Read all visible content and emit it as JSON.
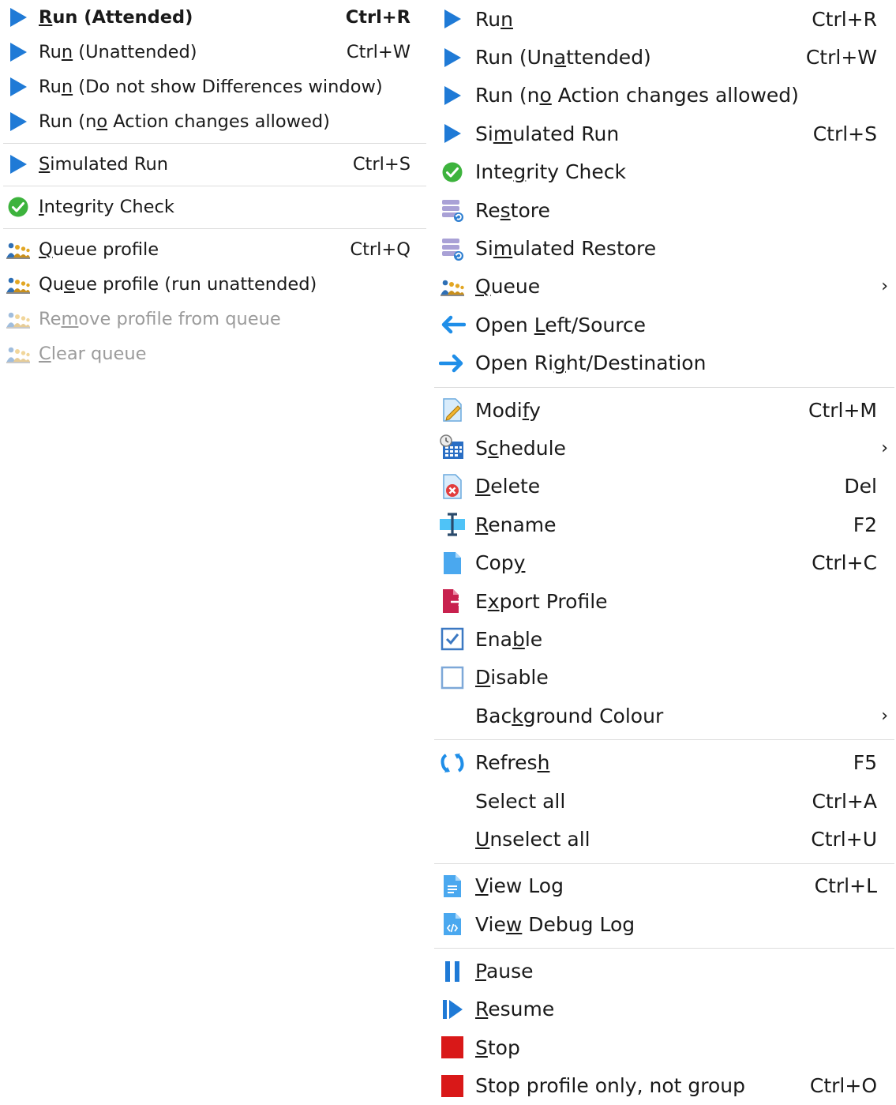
{
  "left_menu": [
    {
      "icon": "play-icon",
      "pre": "",
      "ul": "R",
      "post": "un (Attended)",
      "shortcut": "Ctrl+R",
      "bold": true
    },
    {
      "icon": "play-icon",
      "pre": "Ru",
      "ul": "n",
      "post": " (Unattended)",
      "shortcut": "Ctrl+W"
    },
    {
      "icon": "play-icon",
      "pre": "Ru",
      "ul": "n",
      "post": " (Do not show Differences window)",
      "shortcut": ""
    },
    {
      "icon": "play-icon",
      "pre": "Run (n",
      "ul": "o",
      "post": " Action changes allowed)",
      "shortcut": ""
    },
    {
      "sep": true
    },
    {
      "icon": "play-icon",
      "pre": "",
      "ul": "S",
      "post": "imulated Run",
      "shortcut": "Ctrl+S"
    },
    {
      "sep": true
    },
    {
      "icon": "check-circle-icon",
      "pre": "",
      "ul": "I",
      "post": "ntegrity Check",
      "shortcut": ""
    },
    {
      "sep": true
    },
    {
      "icon": "queue-people-icon",
      "pre": "",
      "ul": "Q",
      "post": "ueue profile",
      "shortcut": "Ctrl+Q"
    },
    {
      "icon": "queue-people-icon",
      "pre": "Qu",
      "ul": "e",
      "post": "ue profile (run unattended)",
      "shortcut": ""
    },
    {
      "icon": "queue-people-icon",
      "pre": "Re",
      "ul": "m",
      "post": "ove profile from queue",
      "shortcut": "",
      "disabled": true
    },
    {
      "icon": "queue-people-icon",
      "pre": "",
      "ul": "C",
      "post": "lear queue",
      "shortcut": "",
      "disabled": true
    }
  ],
  "right_menu": [
    {
      "icon": "play-icon",
      "pre": "Ru",
      "ul": "n",
      "post": "",
      "shortcut": "Ctrl+R"
    },
    {
      "icon": "play-icon",
      "pre": "Run (Un",
      "ul": "a",
      "post": "ttended)",
      "shortcut": "Ctrl+W"
    },
    {
      "icon": "play-icon",
      "pre": "Run (n",
      "ul": "o",
      "post": " Action changes allowed)",
      "shortcut": ""
    },
    {
      "icon": "play-icon",
      "pre": "Si",
      "ul": "m",
      "post": "ulated Run",
      "shortcut": "Ctrl+S"
    },
    {
      "icon": "check-circle-icon",
      "pre": "Inte",
      "ul": "g",
      "post": "rity Check",
      "shortcut": ""
    },
    {
      "icon": "restore-database-icon",
      "pre": "Re",
      "ul": "s",
      "post": "tore",
      "shortcut": ""
    },
    {
      "icon": "restore-database-icon",
      "pre": "Si",
      "ul": "m",
      "post": "ulated Restore",
      "shortcut": ""
    },
    {
      "icon": "queue-people-icon",
      "pre": "",
      "ul": "Q",
      "post": "ueue",
      "shortcut": "",
      "submenu": true
    },
    {
      "icon": "arrow-left-icon",
      "pre": "Open ",
      "ul": "L",
      "post": "eft/Source",
      "shortcut": ""
    },
    {
      "icon": "arrow-right-icon",
      "pre": "Open Ri",
      "ul": "g",
      "post": "ht/Destination",
      "shortcut": ""
    },
    {
      "sep": true
    },
    {
      "icon": "pencil-icon",
      "pre": "Modi",
      "ul": "f",
      "post": "y",
      "shortcut": "Ctrl+M"
    },
    {
      "icon": "calendar-clock-icon",
      "pre": "S",
      "ul": "c",
      "post": "hedule",
      "shortcut": "",
      "submenu": true
    },
    {
      "icon": "delete-doc-icon",
      "pre": "",
      "ul": "D",
      "post": "elete",
      "shortcut": "Del"
    },
    {
      "icon": "rename-cursor-icon",
      "pre": "",
      "ul": "R",
      "post": "ename",
      "shortcut": "F2"
    },
    {
      "icon": "copy-doc-icon",
      "pre": "Cop",
      "ul": "y",
      "post": "",
      "shortcut": "Ctrl+C"
    },
    {
      "icon": "export-doc-icon",
      "pre": "E",
      "ul": "x",
      "post": "port Profile",
      "shortcut": ""
    },
    {
      "icon": "checkbox-checked-icon",
      "pre": "Ena",
      "ul": "b",
      "post": "le",
      "shortcut": ""
    },
    {
      "icon": "checkbox-empty-icon",
      "pre": "",
      "ul": "D",
      "post": "isable",
      "shortcut": ""
    },
    {
      "icon": "",
      "pre": "Bac",
      "ul": "k",
      "post": "ground Colour",
      "shortcut": "",
      "submenu": true
    },
    {
      "sep": true
    },
    {
      "icon": "refresh-icon",
      "pre": "Refres",
      "ul": "h",
      "post": "",
      "shortcut": "F5"
    },
    {
      "icon": "",
      "pre": "Select all",
      "ul": "",
      "post": "",
      "shortcut": "Ctrl+A"
    },
    {
      "icon": "",
      "pre": "",
      "ul": "U",
      "post": "nselect all",
      "shortcut": "Ctrl+U"
    },
    {
      "sep": true
    },
    {
      "icon": "view-log-icon",
      "pre": "",
      "ul": "V",
      "post": "iew Log",
      "shortcut": "Ctrl+L"
    },
    {
      "icon": "debug-log-icon",
      "pre": "Vie",
      "ul": "w",
      "post": " Debug Log",
      "shortcut": ""
    },
    {
      "sep": true
    },
    {
      "icon": "pause-icon",
      "pre": "",
      "ul": "P",
      "post": "ause",
      "shortcut": ""
    },
    {
      "icon": "resume-icon",
      "pre": "",
      "ul": "R",
      "post": "esume",
      "shortcut": ""
    },
    {
      "icon": "stop-icon",
      "pre": "",
      "ul": "S",
      "post": "top",
      "shortcut": ""
    },
    {
      "icon": "stop-icon",
      "pre": "Stop profile only, not group",
      "ul": "",
      "post": "",
      "shortcut": "Ctrl+O"
    }
  ],
  "submenu_arrow": "›"
}
